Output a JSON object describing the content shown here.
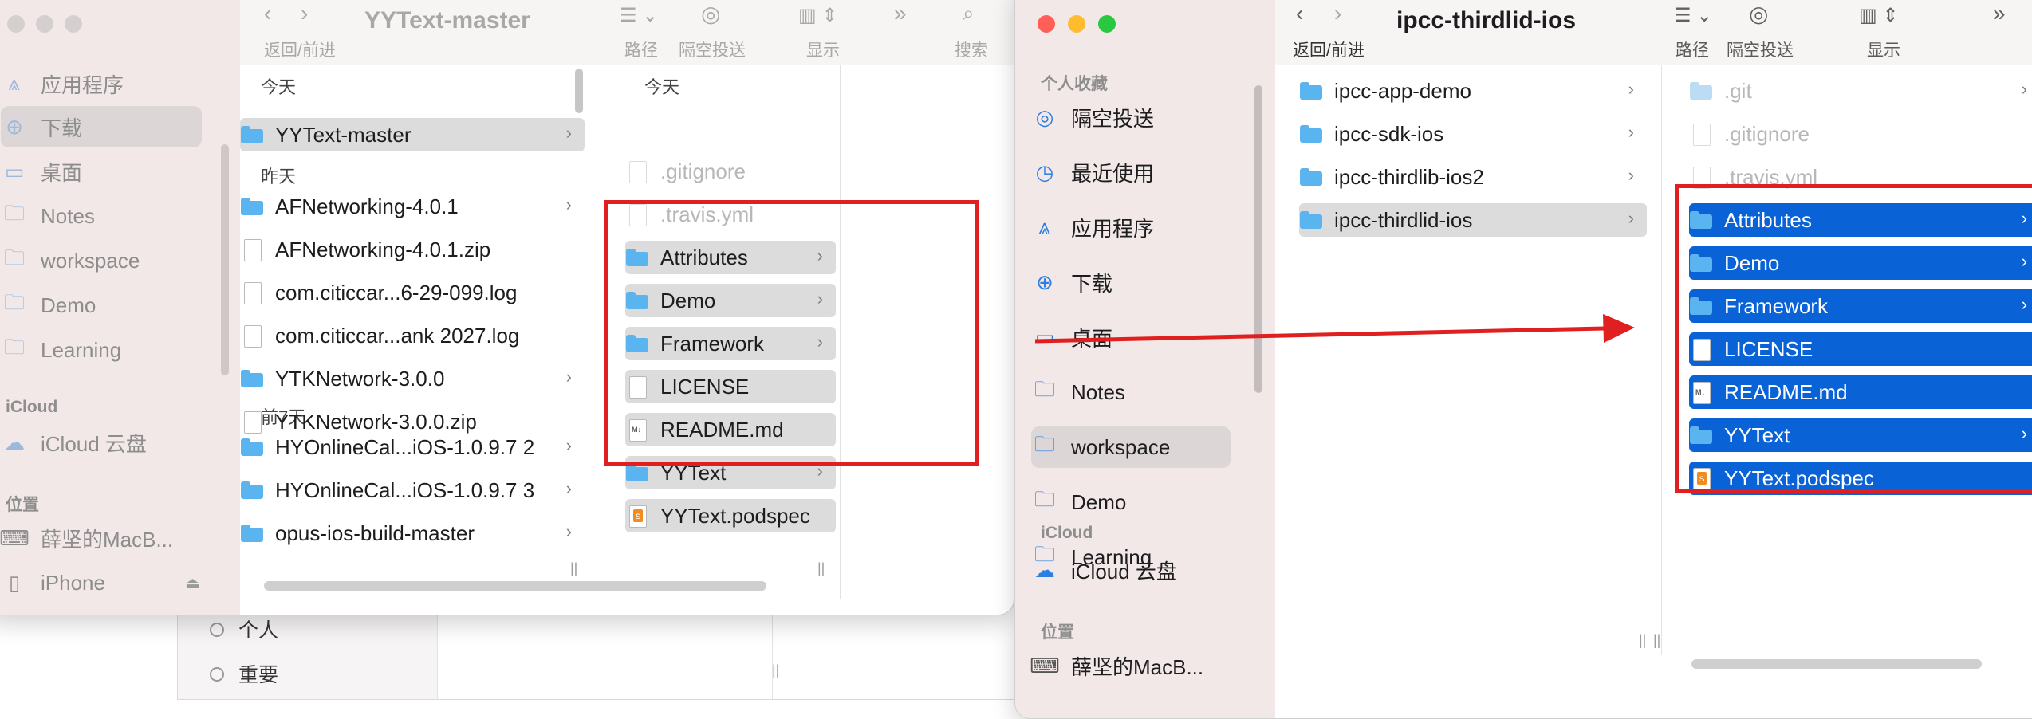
{
  "colors": {
    "selection_blue": "#0a63d6",
    "folder_blue": "#5ab4f0",
    "annotation_red": "#e02020",
    "close": "#ff5f57",
    "minimize": "#febc2e",
    "zoom": "#28c840"
  },
  "left": {
    "title": "YYText-master",
    "toolbar": {
      "back_forward": "返回/前进",
      "path": "路径",
      "airdrop": "隔空投送",
      "view": "显示",
      "search": "搜索"
    },
    "sidebar": {
      "items": [
        {
          "label": "应用程序",
          "icon": "applications-icon"
        },
        {
          "label": "下载",
          "icon": "download-icon"
        },
        {
          "label": "桌面",
          "icon": "desktop-icon"
        },
        {
          "label": "Notes",
          "icon": "folder-icon"
        },
        {
          "label": "workspace",
          "icon": "folder-icon"
        },
        {
          "label": "Demo",
          "icon": "folder-icon"
        },
        {
          "label": "Learning",
          "icon": "folder-icon"
        }
      ],
      "icloud_header": "iCloud",
      "icloud_item": "iCloud 云盘",
      "locations_header": "位置",
      "locations": [
        "薛坚的MacB...",
        "iPhone"
      ]
    },
    "col1": {
      "today": "今天",
      "today_items": [
        {
          "name": "YYText-master",
          "type": "folder"
        }
      ],
      "yesterday": "昨天",
      "yesterday_items": [
        {
          "name": "AFNetworking-4.0.1",
          "type": "folder"
        },
        {
          "name": "AFNetworking-4.0.1.zip",
          "type": "zip"
        },
        {
          "name": "com.citiccar...6-29-099.log",
          "type": "doc"
        },
        {
          "name": "com.citiccar...ank 2027.log",
          "type": "doc"
        },
        {
          "name": "YTKNetwork-3.0.0",
          "type": "folder"
        },
        {
          "name": "YTKNetwork-3.0.0.zip",
          "type": "zip"
        }
      ],
      "week": "前7天",
      "week_items": [
        {
          "name": "HYOnlineCal...iOS-1.0.9.7 2",
          "type": "folder"
        },
        {
          "name": "HYOnlineCal...iOS-1.0.9.7 3",
          "type": "folder"
        },
        {
          "name": "opus-ios-build-master",
          "type": "folder"
        }
      ]
    },
    "col2": {
      "today": "今天",
      "hidden": [
        ".gitignore",
        ".travis.yml"
      ],
      "items": [
        {
          "name": "Attributes",
          "type": "folder"
        },
        {
          "name": "Demo",
          "type": "folder"
        },
        {
          "name": "Framework",
          "type": "folder"
        },
        {
          "name": "LICENSE",
          "type": "doc"
        },
        {
          "name": "README.md",
          "type": "md"
        },
        {
          "name": "YYText",
          "type": "folder"
        },
        {
          "name": "YYText.podspec",
          "type": "swift"
        }
      ]
    }
  },
  "background": {
    "tags": [
      "个人",
      "重要"
    ]
  },
  "right": {
    "title": "ipcc-thirdlid-ios",
    "toolbar": {
      "back_forward": "返回/前进",
      "path": "路径",
      "airdrop": "隔空投送",
      "view": "显示"
    },
    "sidebar": {
      "favorites_header": "个人收藏",
      "items": [
        {
          "label": "隔空投送",
          "icon": "airdrop-icon"
        },
        {
          "label": "最近使用",
          "icon": "recents-icon"
        },
        {
          "label": "应用程序",
          "icon": "applications-icon"
        },
        {
          "label": "下载",
          "icon": "download-icon"
        },
        {
          "label": "桌面",
          "icon": "desktop-icon"
        },
        {
          "label": "Notes",
          "icon": "folder-icon"
        },
        {
          "label": "workspace",
          "icon": "folder-icon"
        },
        {
          "label": "Demo",
          "icon": "folder-icon"
        },
        {
          "label": "Learning",
          "icon": "folder-icon"
        }
      ],
      "icloud_header": "iCloud",
      "icloud_item": "iCloud 云盘",
      "locations_header": "位置",
      "locations": [
        "薛坚的MacB..."
      ]
    },
    "col1": [
      {
        "name": "ipcc-app-demo",
        "type": "folder"
      },
      {
        "name": "ipcc-sdk-ios",
        "type": "folder"
      },
      {
        "name": "ipcc-thirdlib-ios2",
        "type": "folder"
      },
      {
        "name": "ipcc-thirdlid-ios",
        "type": "folder"
      }
    ],
    "col2": {
      "hidden": [
        ".git",
        ".gitignore",
        ".travis.yml"
      ],
      "items": [
        {
          "name": "Attributes",
          "type": "folder"
        },
        {
          "name": "Demo",
          "type": "folder"
        },
        {
          "name": "Framework",
          "type": "folder"
        },
        {
          "name": "LICENSE",
          "type": "doc"
        },
        {
          "name": "README.md",
          "type": "md"
        },
        {
          "name": "YYText",
          "type": "folder"
        },
        {
          "name": "YYText.podspec",
          "type": "swift"
        }
      ]
    }
  }
}
